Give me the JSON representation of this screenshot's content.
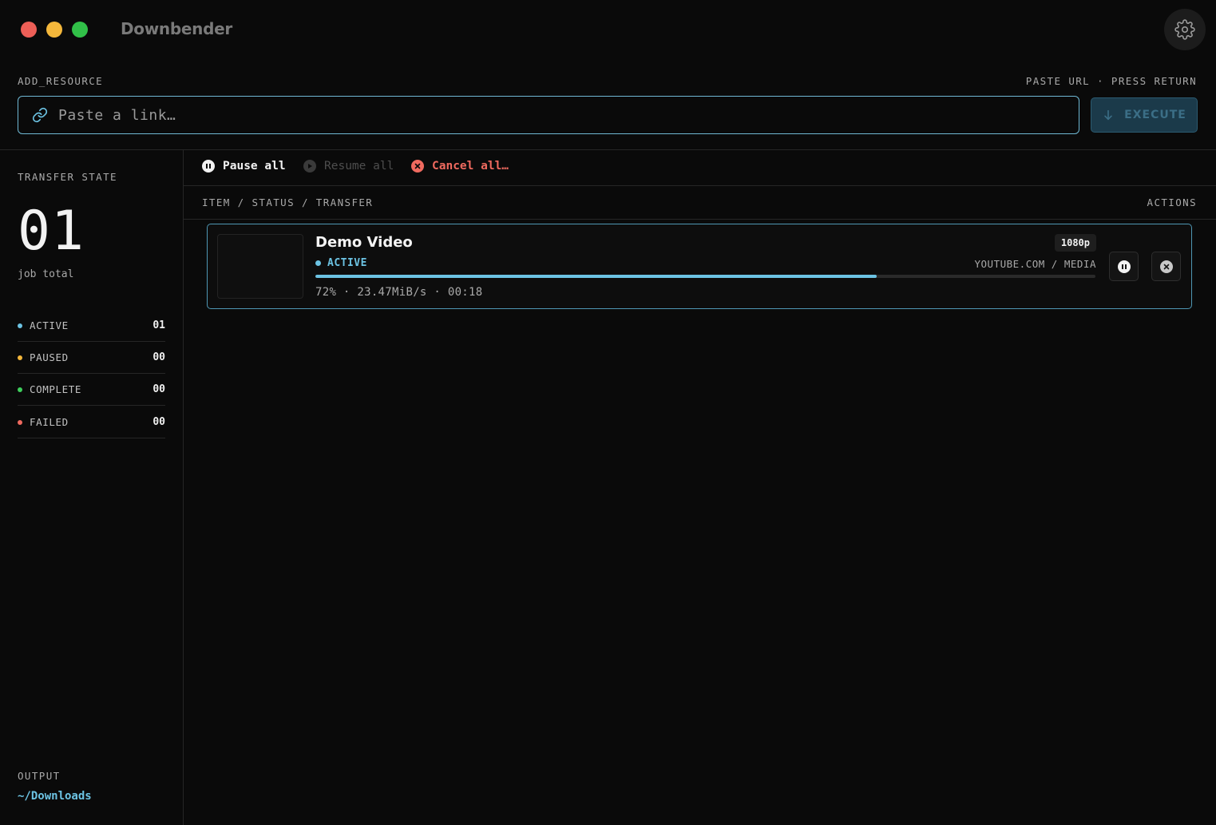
{
  "app": {
    "title": "Downbender"
  },
  "add_resource": {
    "label": "ADD_RESOURCE",
    "hint": "PASTE URL · PRESS RETURN",
    "placeholder": "Paste a link…",
    "execute_label": "EXECUTE"
  },
  "sidebar": {
    "section_label": "TRANSFER STATE",
    "job_count": "01",
    "job_count_label": "job total",
    "stats": [
      {
        "name": "ACTIVE",
        "value": "01",
        "color": "#6cc3e3"
      },
      {
        "name": "PAUSED",
        "value": "00",
        "color": "#f4b73b"
      },
      {
        "name": "COMPLETE",
        "value": "00",
        "color": "#3ecf5c"
      },
      {
        "name": "FAILED",
        "value": "00",
        "color": "#f06a5f"
      }
    ],
    "output_label": "OUTPUT",
    "output_path": "~/Downloads"
  },
  "toolbar": {
    "pause_all": "Pause all",
    "resume_all": "Resume all",
    "cancel_all": "Cancel all…"
  },
  "list": {
    "header_left": "ITEM / STATUS / TRANSFER",
    "header_right": "ACTIONS",
    "items": [
      {
        "title": "Demo Video",
        "status": "ACTIVE",
        "quality": "1080p",
        "source": "YOUTUBE.COM / MEDIA",
        "progress_percent": 72,
        "meta": "72% · 23.47MiB/s · 00:18"
      }
    ]
  },
  "colors": {
    "accent": "#6cc3e3",
    "danger": "#f06a5f",
    "background": "#0a0a0a"
  },
  "icons": {
    "settings": "gear-icon",
    "link": "link-icon",
    "execute": "arrow-down-icon",
    "pause": "pause-icon",
    "resume": "play-icon",
    "cancel": "close-circle-icon"
  }
}
